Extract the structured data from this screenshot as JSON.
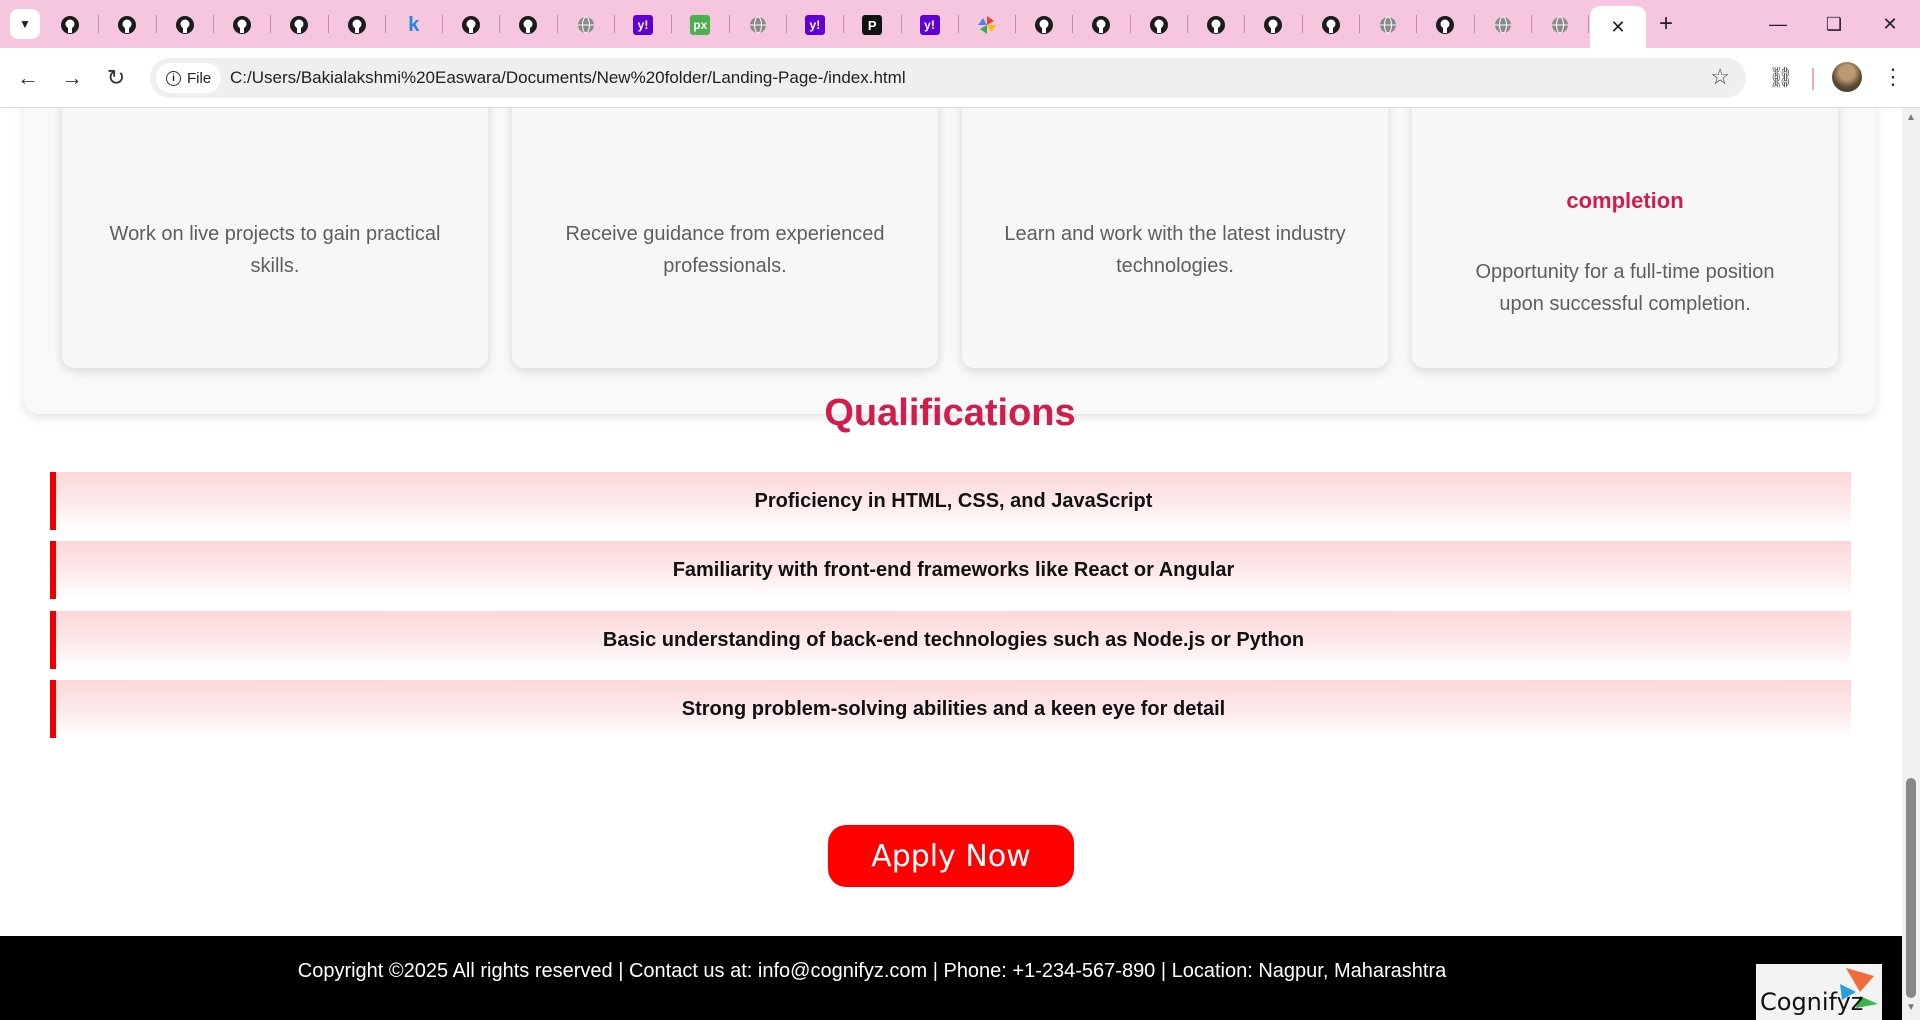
{
  "browser": {
    "tab_icons": [
      "github-icon",
      "github-icon",
      "github-icon",
      "github-icon",
      "github-icon",
      "github-icon",
      "k-icon",
      "github-icon",
      "github-icon",
      "globe-icon",
      "yahoo-icon",
      "pixabay-icon",
      "globe-icon",
      "yahoo-icon",
      "p-icon",
      "yahoo-icon",
      "pinwheel-icon",
      "github-icon",
      "github-icon",
      "github-icon",
      "github-icon",
      "github-icon",
      "github-icon",
      "globe-icon",
      "github-icon",
      "globe-icon",
      "globe-icon"
    ],
    "site_info_label": "File",
    "url": "C:/Users/Bakialakshmi%20Easwara/Documents/New%20folder/Landing-Page-/index.html"
  },
  "benefits": [
    {
      "title": "",
      "description": "Work on live projects to gain practical skills."
    },
    {
      "title": "",
      "description": "Receive guidance from experienced professionals."
    },
    {
      "title": "",
      "description": "Learn and work with the latest industry technologies."
    },
    {
      "title": "completion",
      "description": "Opportunity for a full-time position upon successful completion."
    }
  ],
  "qualifications": {
    "heading": "Qualifications",
    "items": [
      "Proficiency in HTML, CSS, and JavaScript",
      "Familiarity with front-end frameworks like React or Angular",
      "Basic understanding of back-end technologies such as Node.js or Python",
      "Strong problem-solving abilities and a keen eye for detail"
    ]
  },
  "apply_button_label": "Apply Now",
  "footer": {
    "text": "Copyright ©2025 All rights reserved | Contact us at: info@cognifyz.com | Phone: +1-234-567-890 | Location: Nagpur, Maharashtra",
    "logo_text": "Cognifyz"
  },
  "colors": {
    "accent": "#d11c4c",
    "apply_button": "#ff0000",
    "qualification_border": "#ee0000",
    "footer_bg": "#000000",
    "tabstrip_bg": "#f5c6dd"
  }
}
